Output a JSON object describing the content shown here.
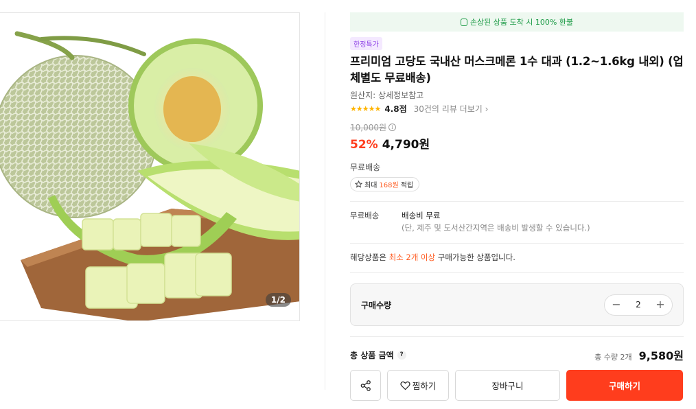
{
  "gallery": {
    "counter": "1/2"
  },
  "banner": {
    "text": "손상된 상품 도착 시 100% 환불"
  },
  "product": {
    "badge": "한정특가",
    "title": "프리미엄 고당도 국내산 머스크메론 1수 대과 (1.2~1.6kg 내외) (업체별도 무료배송)",
    "origin": "원산지: 상세정보참고",
    "rating": {
      "stars": "★★★★★",
      "score": "4.8점",
      "review_link": "30건의 리뷰 더보기",
      "chevron": "›"
    },
    "original_price": "10,000원",
    "info_icon_glyph": "i",
    "discount": "52%",
    "price": "4,790원"
  },
  "shipping": {
    "label": "무료배송",
    "points": {
      "prefix": "최대",
      "amount": "168원",
      "suffix": "적립"
    },
    "detail_key": "무료배송",
    "detail_value": "배송비 무료",
    "detail_note": "(단, 제주 및 도서산간지역은 배송비 발생할 수 있습니다.)"
  },
  "min_order": {
    "prefix": "해당상품은",
    "highlight": "최소 2개 이상",
    "suffix": "구매가능한 상품입니다."
  },
  "quantity": {
    "label": "구매수량",
    "minus": "−",
    "value": "2",
    "plus": "+"
  },
  "total": {
    "label": "총 상품 금액",
    "help_glyph": "?",
    "qty_text": "총 수량 2개",
    "price": "9,580원"
  },
  "actions": {
    "wish_label": "찜하기",
    "cart_label": "장바구니",
    "buy_label": "구매하기"
  },
  "colors": {
    "accent": "#ff3d1d",
    "refund_green": "#1a9a44",
    "badge_purple": "#8b3ee6",
    "star": "#ffb400"
  },
  "icons": [
    "share-icon",
    "heart-icon",
    "coin-icon",
    "points-icon",
    "info-icon",
    "help-icon",
    "chevron-right-icon"
  ]
}
